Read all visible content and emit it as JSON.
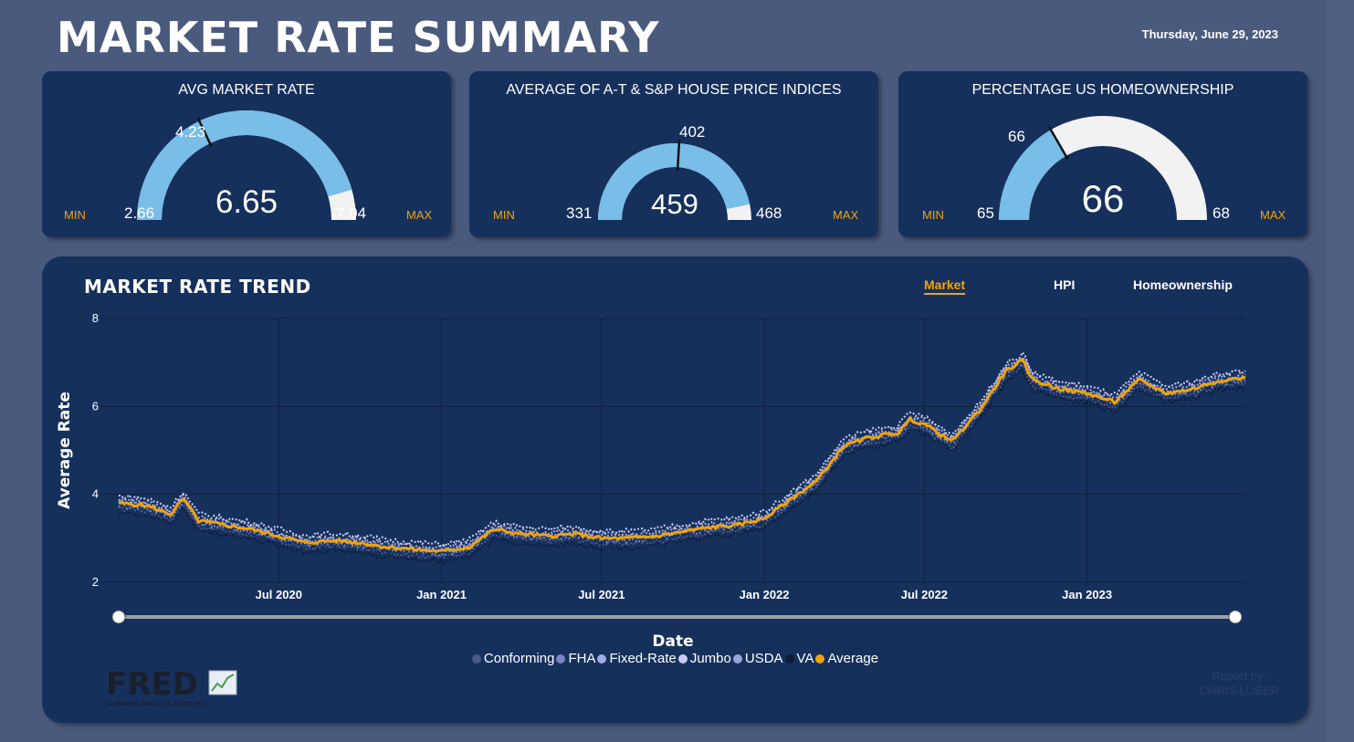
{
  "header": {
    "title": "MARKET RATE SUMMARY",
    "date": "Thursday, June 29, 2023"
  },
  "cards": [
    {
      "title": "AVG MARKET RATE",
      "min_label": "MIN",
      "max_label": "MAX",
      "min": "2.66",
      "max": "7.04",
      "target": "4.23",
      "value": "6.65",
      "value_num": 6.65,
      "min_num": 2.66,
      "max_num": 7.04,
      "target_num": 4.23
    },
    {
      "title": "AVERAGE OF A-T & S&P HOUSE PRICE INDICES",
      "min_label": "MIN",
      "max_label": "MAX",
      "min": "331",
      "max": "468",
      "target": "402",
      "value": "459",
      "value_num": 459,
      "min_num": 331,
      "max_num": 468,
      "target_num": 402
    },
    {
      "title": "PERCENTAGE US HOMEOWNERSHIP",
      "min_label": "MIN",
      "max_label": "MAX",
      "min": "65",
      "max": "68",
      "target": "66",
      "value": "66",
      "value_num": 66,
      "min_num": 65,
      "max_num": 68,
      "target_num": 66
    }
  ],
  "trend": {
    "title": "MARKET RATE TREND",
    "tabs": [
      "Market",
      "HPI",
      "Homeownership"
    ],
    "active_tab": "Market",
    "legend": [
      "Conforming",
      "FHA",
      "Fixed-Rate",
      "Jumbo",
      "USDA",
      "VA",
      "Average"
    ]
  },
  "footer": {
    "logo_text": "FRED",
    "logo_sub": "ECONOMIC DATA  |  ST. LOUIS FED",
    "report_by_label": "Report by:",
    "report_by_name": "CHRIS LUBER"
  },
  "colors": {
    "accent": "#f0a30a",
    "gauge_fill": "#79bde9",
    "gauge_bg": "#f2f2f2",
    "card_bg": "#16305c"
  },
  "chart_data": {
    "type": "line",
    "xlabel": "Date",
    "ylabel": "Average Rate",
    "ylim": [
      2,
      8
    ],
    "yticks": [
      "2",
      "4",
      "6",
      "8"
    ],
    "xticks": [
      "Jul 2020",
      "Jan 2021",
      "Jul 2021",
      "Jan 2022",
      "Jul 2022",
      "Jan 2023"
    ],
    "legend_position": "bottom",
    "grid": true,
    "x": [
      "2020-01-02",
      "2020-02-01",
      "2020-03-01",
      "2020-03-15",
      "2020-04-01",
      "2020-05-01",
      "2020-06-01",
      "2020-07-01",
      "2020-08-01",
      "2020-09-01",
      "2020-10-01",
      "2020-11-01",
      "2020-12-01",
      "2021-01-01",
      "2021-02-01",
      "2021-03-01",
      "2021-04-01",
      "2021-05-01",
      "2021-06-01",
      "2021-07-01",
      "2021-08-01",
      "2021-09-01",
      "2021-10-01",
      "2021-11-01",
      "2021-12-01",
      "2022-01-01",
      "2022-02-01",
      "2022-03-01",
      "2022-04-01",
      "2022-05-01",
      "2022-06-01",
      "2022-06-15",
      "2022-07-01",
      "2022-08-01",
      "2022-09-01",
      "2022-10-01",
      "2022-10-20",
      "2022-11-01",
      "2022-12-01",
      "2023-01-01",
      "2023-02-01",
      "2023-03-01",
      "2023-04-01",
      "2023-05-01",
      "2023-06-01",
      "2023-06-29"
    ],
    "series": [
      {
        "name": "Average",
        "color": "#f0a30a",
        "values": [
          3.8,
          3.75,
          3.55,
          3.9,
          3.4,
          3.3,
          3.2,
          3.05,
          2.9,
          2.95,
          2.9,
          2.8,
          2.75,
          2.7,
          2.8,
          3.2,
          3.1,
          3.05,
          3.1,
          3.0,
          3.0,
          3.05,
          3.15,
          3.25,
          3.3,
          3.45,
          3.9,
          4.3,
          5.1,
          5.3,
          5.4,
          5.7,
          5.6,
          5.2,
          5.9,
          6.8,
          7.04,
          6.6,
          6.4,
          6.3,
          6.1,
          6.6,
          6.3,
          6.4,
          6.6,
          6.65
        ]
      },
      {
        "name": "Conforming",
        "color": "#4a5a8c",
        "offset": -0.12
      },
      {
        "name": "FHA",
        "color": "#7b84c4",
        "offset": -0.05
      },
      {
        "name": "Fixed-Rate",
        "color": "#a3a9e6",
        "offset": 0.08
      },
      {
        "name": "Jumbo",
        "color": "#c8ccf5",
        "offset": 0.16
      },
      {
        "name": "USDA",
        "color": "#9ba3d9",
        "offset": 0.03
      },
      {
        "name": "VA",
        "color": "#0d1a38",
        "offset": -0.22
      }
    ]
  }
}
